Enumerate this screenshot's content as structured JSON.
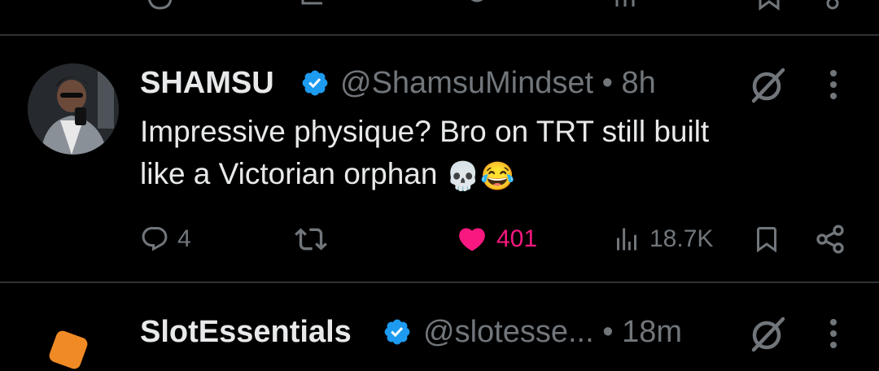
{
  "colors": {
    "background": "#000000",
    "text_primary": "#e7e9ea",
    "text_secondary": "#71767b",
    "verified_blue": "#1d9bf0",
    "like_pink": "#f91880",
    "divider": "#2f3336"
  },
  "tweet": {
    "display_name": "SHAMSU",
    "handle": "@ShamsuMindset",
    "separator": "•",
    "time": "8h",
    "text_line1": "Impressive physique? Bro on TRT still built",
    "text_line2": "like a Victorian orphan",
    "emoji1": "💀",
    "emoji2": "😂",
    "avatar_icon": "user-avatar",
    "actions": {
      "reply_count": "4",
      "repost_count": "",
      "like_count": "401",
      "liked": true,
      "views_count": "18.7K"
    }
  },
  "next_tweet": {
    "display_name": "SlotEssentials",
    "handle": "@slotesse...",
    "separator": "•",
    "time": "18m"
  }
}
